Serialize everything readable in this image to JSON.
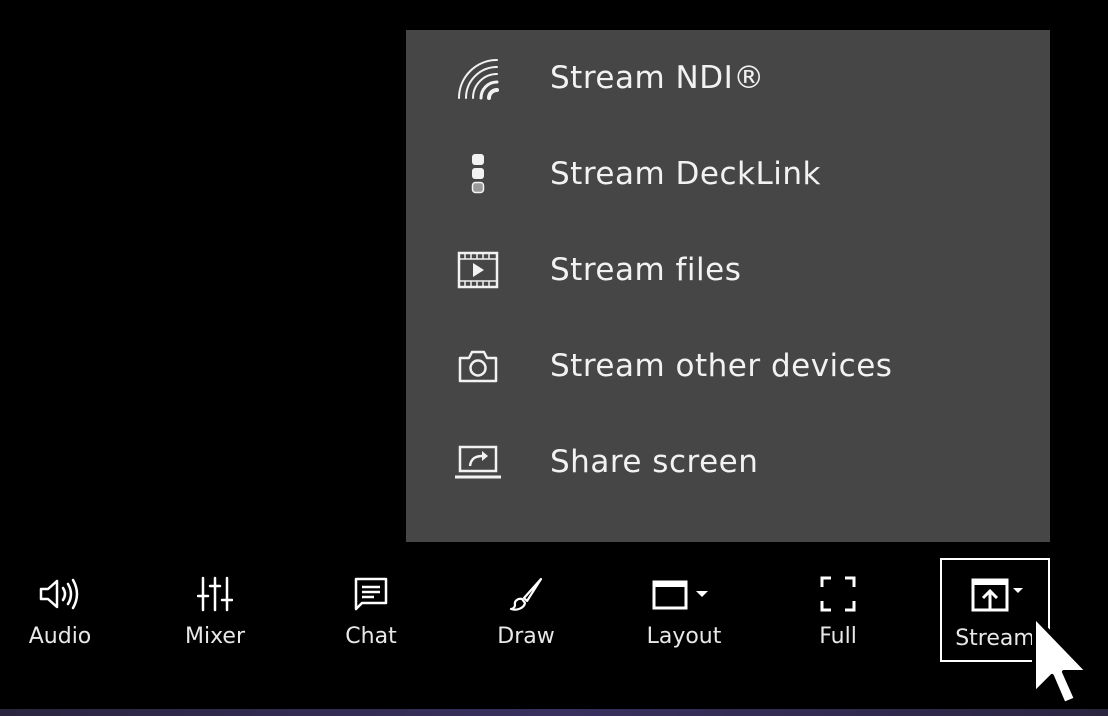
{
  "menu": {
    "items": [
      {
        "label": "Stream NDI®",
        "icon": "ndi-signal-icon"
      },
      {
        "label": "Stream DeckLink",
        "icon": "decklink-icon"
      },
      {
        "label": "Stream files",
        "icon": "film-play-icon"
      },
      {
        "label": "Stream other devices",
        "icon": "camera-icon"
      },
      {
        "label": "Share screen",
        "icon": "share-screen-icon"
      }
    ]
  },
  "toolbar": {
    "buttons": [
      {
        "label": "Audio",
        "icon": "speaker-icon"
      },
      {
        "label": "Mixer",
        "icon": "sliders-icon"
      },
      {
        "label": "Chat",
        "icon": "chat-icon"
      },
      {
        "label": "Draw",
        "icon": "brush-icon"
      },
      {
        "label": "Layout",
        "icon": "layout-icon"
      },
      {
        "label": "Full",
        "icon": "fullscreen-icon"
      },
      {
        "label": "Stream",
        "icon": "stream-upload-icon",
        "active": true
      }
    ]
  },
  "colors": {
    "background": "#000000",
    "menu_background": "#464646",
    "text": "#f2f2f2"
  }
}
